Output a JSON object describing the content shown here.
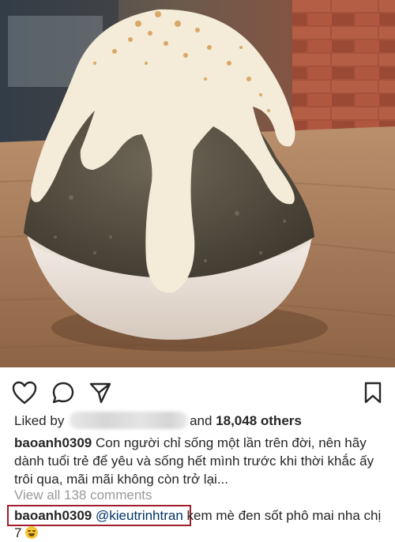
{
  "post": {
    "image_alt": "Shaved ice dessert with cheese sauce in a white bowl",
    "actions": {
      "like_icon": "heart-outline-icon",
      "comment_icon": "speech-bubble-icon",
      "share_icon": "paper-plane-icon",
      "save_icon": "bookmark-icon"
    },
    "likes": {
      "prefix": "Liked by",
      "conjunction": "and",
      "count": "18,048 others"
    },
    "caption": {
      "username": "baoanh0309",
      "text": "Con người chỉ sống một lần trên đời, nên hãy dành tuổi trẻ để yêu và sống hết mình trước khi thời khắc ấy trôi qua, mãi mãi không còn trở lại..."
    },
    "view_all_comments": "View all 138 comments",
    "comment": {
      "username": "baoanh0309",
      "mention": "@kieutrinhtran",
      "text": "kem mè đen sốt phô mai nha chị 7",
      "emoji": "laughing-emoji"
    },
    "colors": {
      "text": "#262626",
      "muted": "#999999",
      "mention": "#003569",
      "highlight_border": "#a11d2a"
    }
  }
}
